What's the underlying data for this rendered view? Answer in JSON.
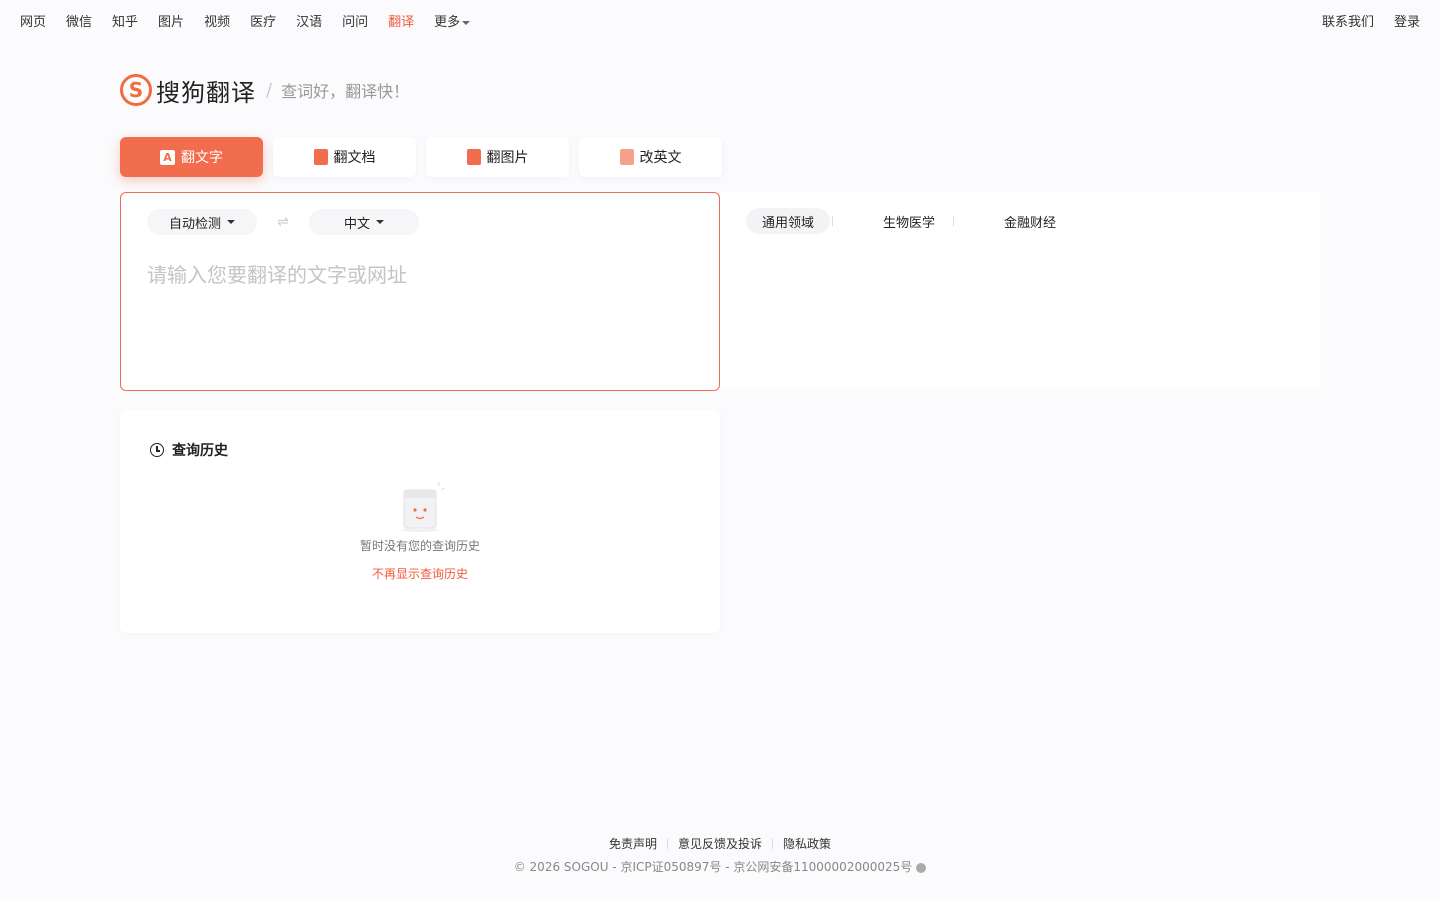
{
  "topnav": {
    "left_items": [
      "网页",
      "微信",
      "知乎",
      "图片",
      "视频",
      "医疗",
      "汉语",
      "问问",
      "翻译",
      "更多"
    ],
    "active_item": "翻译",
    "right_items": [
      "联系我们",
      "登录"
    ]
  },
  "brand": {
    "logo_letter": "S",
    "name": "搜狗翻译",
    "separator": "/",
    "slogan": "查词好，翻译快！"
  },
  "tabs": [
    {
      "label": "翻文字",
      "icon": "text-translate-icon",
      "icon_glyph": "A",
      "active": true
    },
    {
      "label": "翻文档",
      "icon": "document-icon",
      "active": false
    },
    {
      "label": "翻图片",
      "icon": "image-icon",
      "active": false
    },
    {
      "label": "改英文",
      "icon": "edit-english-icon",
      "active": false
    }
  ],
  "input": {
    "source_lang": "自动检测",
    "swap_glyph": "⇌",
    "target_lang": "中文",
    "placeholder": "请输入您要翻译的文字或网址",
    "value": ""
  },
  "output": {
    "domains": [
      "通用领域",
      "生物医学",
      "金融财经"
    ],
    "active_domain": "通用领域"
  },
  "history": {
    "title": "查询历史",
    "empty_text": "暂时没有您的查询历史",
    "hide_link": "不再显示查询历史"
  },
  "footer": {
    "links": [
      "免责声明",
      "意见反馈及投诉",
      "隐私政策"
    ],
    "copyright": "© 2026 SOGOU - 京ICP证050897号 - 京公网安备11000002000025号"
  },
  "colors": {
    "accent": "#f26d4e",
    "active_nav": "#f05a3c",
    "background": "#fbfbfd"
  }
}
